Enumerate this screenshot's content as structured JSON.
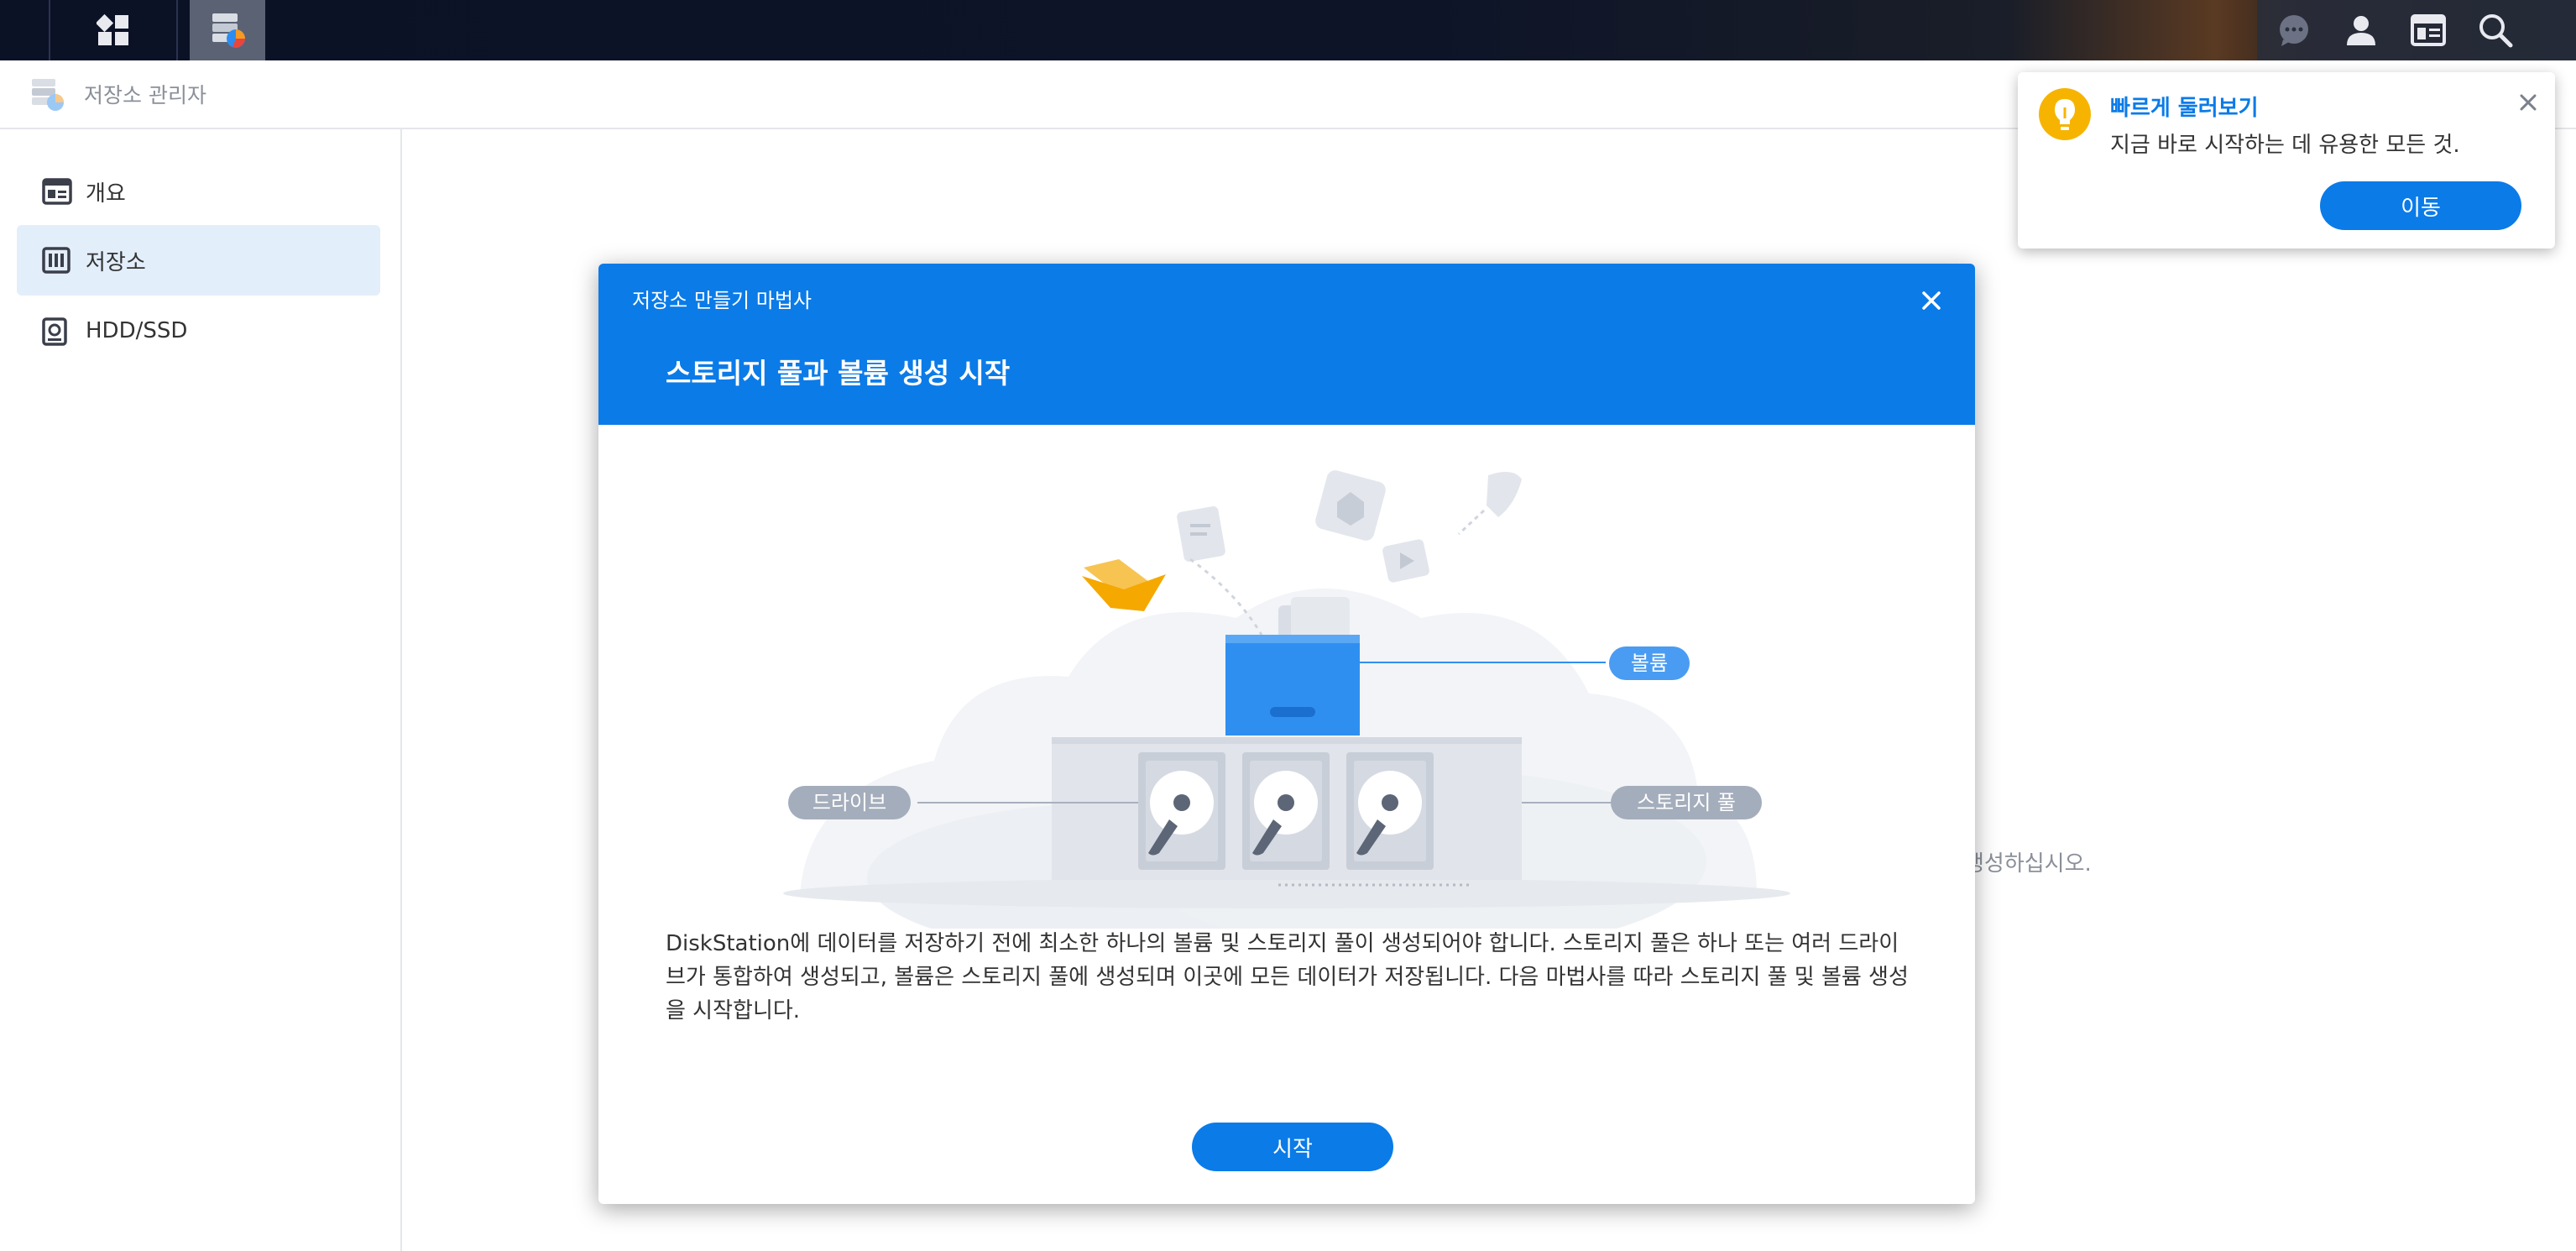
{
  "app": {
    "title": "저장소 관리자"
  },
  "sidebar": {
    "items": [
      {
        "label": "개요",
        "icon": "overview-icon"
      },
      {
        "label": "저장소",
        "icon": "storage-icon",
        "active": true
      },
      {
        "label": "HDD/SSD",
        "icon": "hdd-icon"
      }
    ]
  },
  "background": {
    "hint_text": "생성하십시오."
  },
  "dialog": {
    "wizard_title": "저장소 만들기 마법사",
    "heading": "스토리지 풀과 볼륨 생성 시작",
    "illustration": {
      "volume_label": "볼륨",
      "drive_label": "드라이브",
      "pool_label": "스토리지 풀"
    },
    "body": "DiskStation에 데이터를 저장하기 전에 최소한 하나의 볼륨 및 스토리지 풀이 생성되어야 합니다. 스토리지 풀은 하나 또는 여러 드라이브가 통합하여 생성되고, 볼륨은 스토리지 풀에 생성되며 이곳에 모든 데이터가 저장됩니다. 다음 마법사를 따라 스토리지 풀 및 볼륨 생성을 시작합니다.",
    "start_button": "시작"
  },
  "toast": {
    "title": "빠르게 둘러보기",
    "message": "지금 바로 시작하는 데 유용한 모든 것.",
    "button": "이동"
  },
  "colors": {
    "accent": "#0b7be8",
    "taskbar": "#0c1226",
    "active_item": "#e3eefb"
  }
}
